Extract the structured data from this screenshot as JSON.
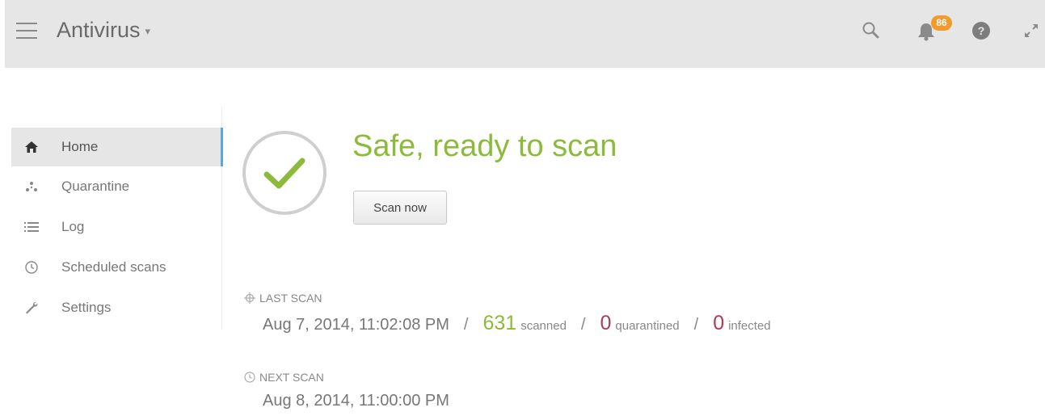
{
  "header": {
    "title": "Antivirus",
    "caret": "▾",
    "notification_count": "86",
    "icons": [
      "hamburger-icon",
      "search-icon",
      "bell-icon",
      "help-icon",
      "expand-icon"
    ]
  },
  "sidebar": {
    "items": [
      {
        "label": "Home",
        "icon": "home-icon",
        "active": true
      },
      {
        "label": "Quarantine",
        "icon": "quarantine-icon",
        "active": false
      },
      {
        "label": "Log",
        "icon": "list-icon",
        "active": false
      },
      {
        "label": "Scheduled scans",
        "icon": "clock-icon",
        "active": false
      },
      {
        "label": "Settings",
        "icon": "wrench-icon",
        "active": false
      }
    ]
  },
  "status": {
    "title": "Safe, ready to scan",
    "scan_button": "Scan now"
  },
  "last_scan": {
    "label": "LAST SCAN",
    "datetime": "Aug 7, 2014, 11:02:08 PM",
    "sep": "/",
    "scanned_count": "631",
    "scanned_label": "scanned",
    "quarantined_count": "0",
    "quarantined_label": "quarantined",
    "infected_count": "0",
    "infected_label": "infected"
  },
  "next_scan": {
    "label": "NEXT SCAN",
    "datetime": "Aug 8, 2014, 11:00:00 PM"
  },
  "colors": {
    "accent_green": "#8cba3a",
    "alert_red": "#b03a56",
    "active_marker": "#5aa7d6",
    "badge_orange": "#f39a2d",
    "header_bg": "#e6e6e6"
  }
}
